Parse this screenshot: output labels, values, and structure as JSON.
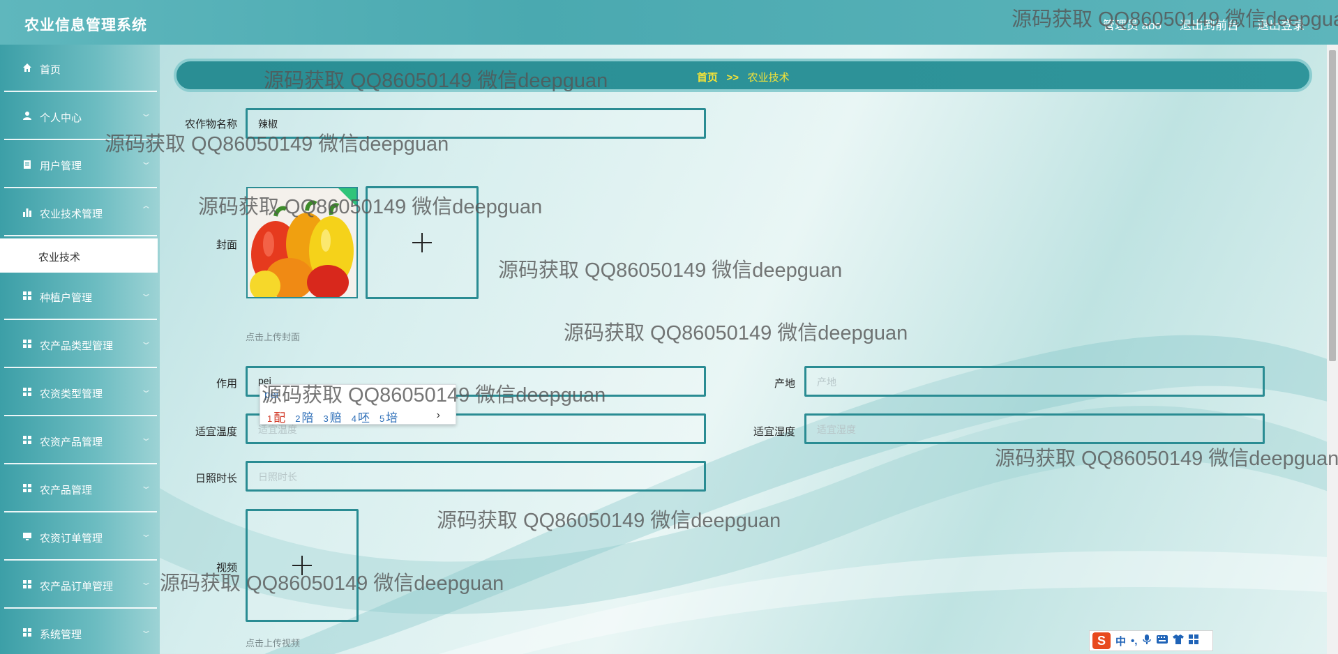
{
  "app": {
    "title": "农业信息管理系统"
  },
  "header": {
    "user": "管理员 abo",
    "to_front": "退出到前台",
    "logout": "退出登录"
  },
  "sidebar": {
    "items": [
      {
        "label": "首页",
        "icon": "home-icon"
      },
      {
        "label": "个人中心",
        "icon": "user-icon"
      },
      {
        "label": "用户管理",
        "icon": "clipboard-icon"
      },
      {
        "label": "农业技术管理",
        "icon": "bar-chart-icon"
      },
      {
        "label": "种植户管理",
        "icon": "grid-icon"
      },
      {
        "label": "农产品类型管理",
        "icon": "grid-icon"
      },
      {
        "label": "农资类型管理",
        "icon": "grid-icon"
      },
      {
        "label": "农资产品管理",
        "icon": "grid-icon"
      },
      {
        "label": "农产品管理",
        "icon": "grid-icon"
      },
      {
        "label": "农资订单管理",
        "icon": "monitor-icon"
      },
      {
        "label": "农产品订单管理",
        "icon": "grid-icon"
      },
      {
        "label": "系统管理",
        "icon": "grid-icon"
      }
    ],
    "active_sub": "农业技术"
  },
  "breadcrumb": {
    "home": "首页",
    "sep": ">>",
    "current": "农业技术"
  },
  "form": {
    "crop_name_label": "农作物名称",
    "crop_name_value": "辣椒",
    "cover_label": "封面",
    "cover_hint": "点击上传封面",
    "effect_label": "作用",
    "effect_value": "pei",
    "origin_label": "产地",
    "origin_placeholder": "产地",
    "temp_label": "适宜温度",
    "temp_placeholder": "适宜温度",
    "humidity_label": "适宜湿度",
    "humidity_placeholder": "适宜湿度",
    "sunlight_label": "日照时长",
    "sunlight_placeholder": "日照时长",
    "video_label": "视频",
    "video_hint": "点击上传视频"
  },
  "ime": {
    "composition": "pei",
    "candidates": [
      {
        "n": "1",
        "c": "配"
      },
      {
        "n": "2",
        "c": "陪"
      },
      {
        "n": "3",
        "c": "赔"
      },
      {
        "n": "4",
        "c": "呸"
      },
      {
        "n": "5",
        "c": "培"
      }
    ],
    "next": "›",
    "bar_logo": "S",
    "bar_mode": "中",
    "bar_punct": "•,"
  },
  "watermark": "源码获取 QQ86050149 微信deepguan"
}
